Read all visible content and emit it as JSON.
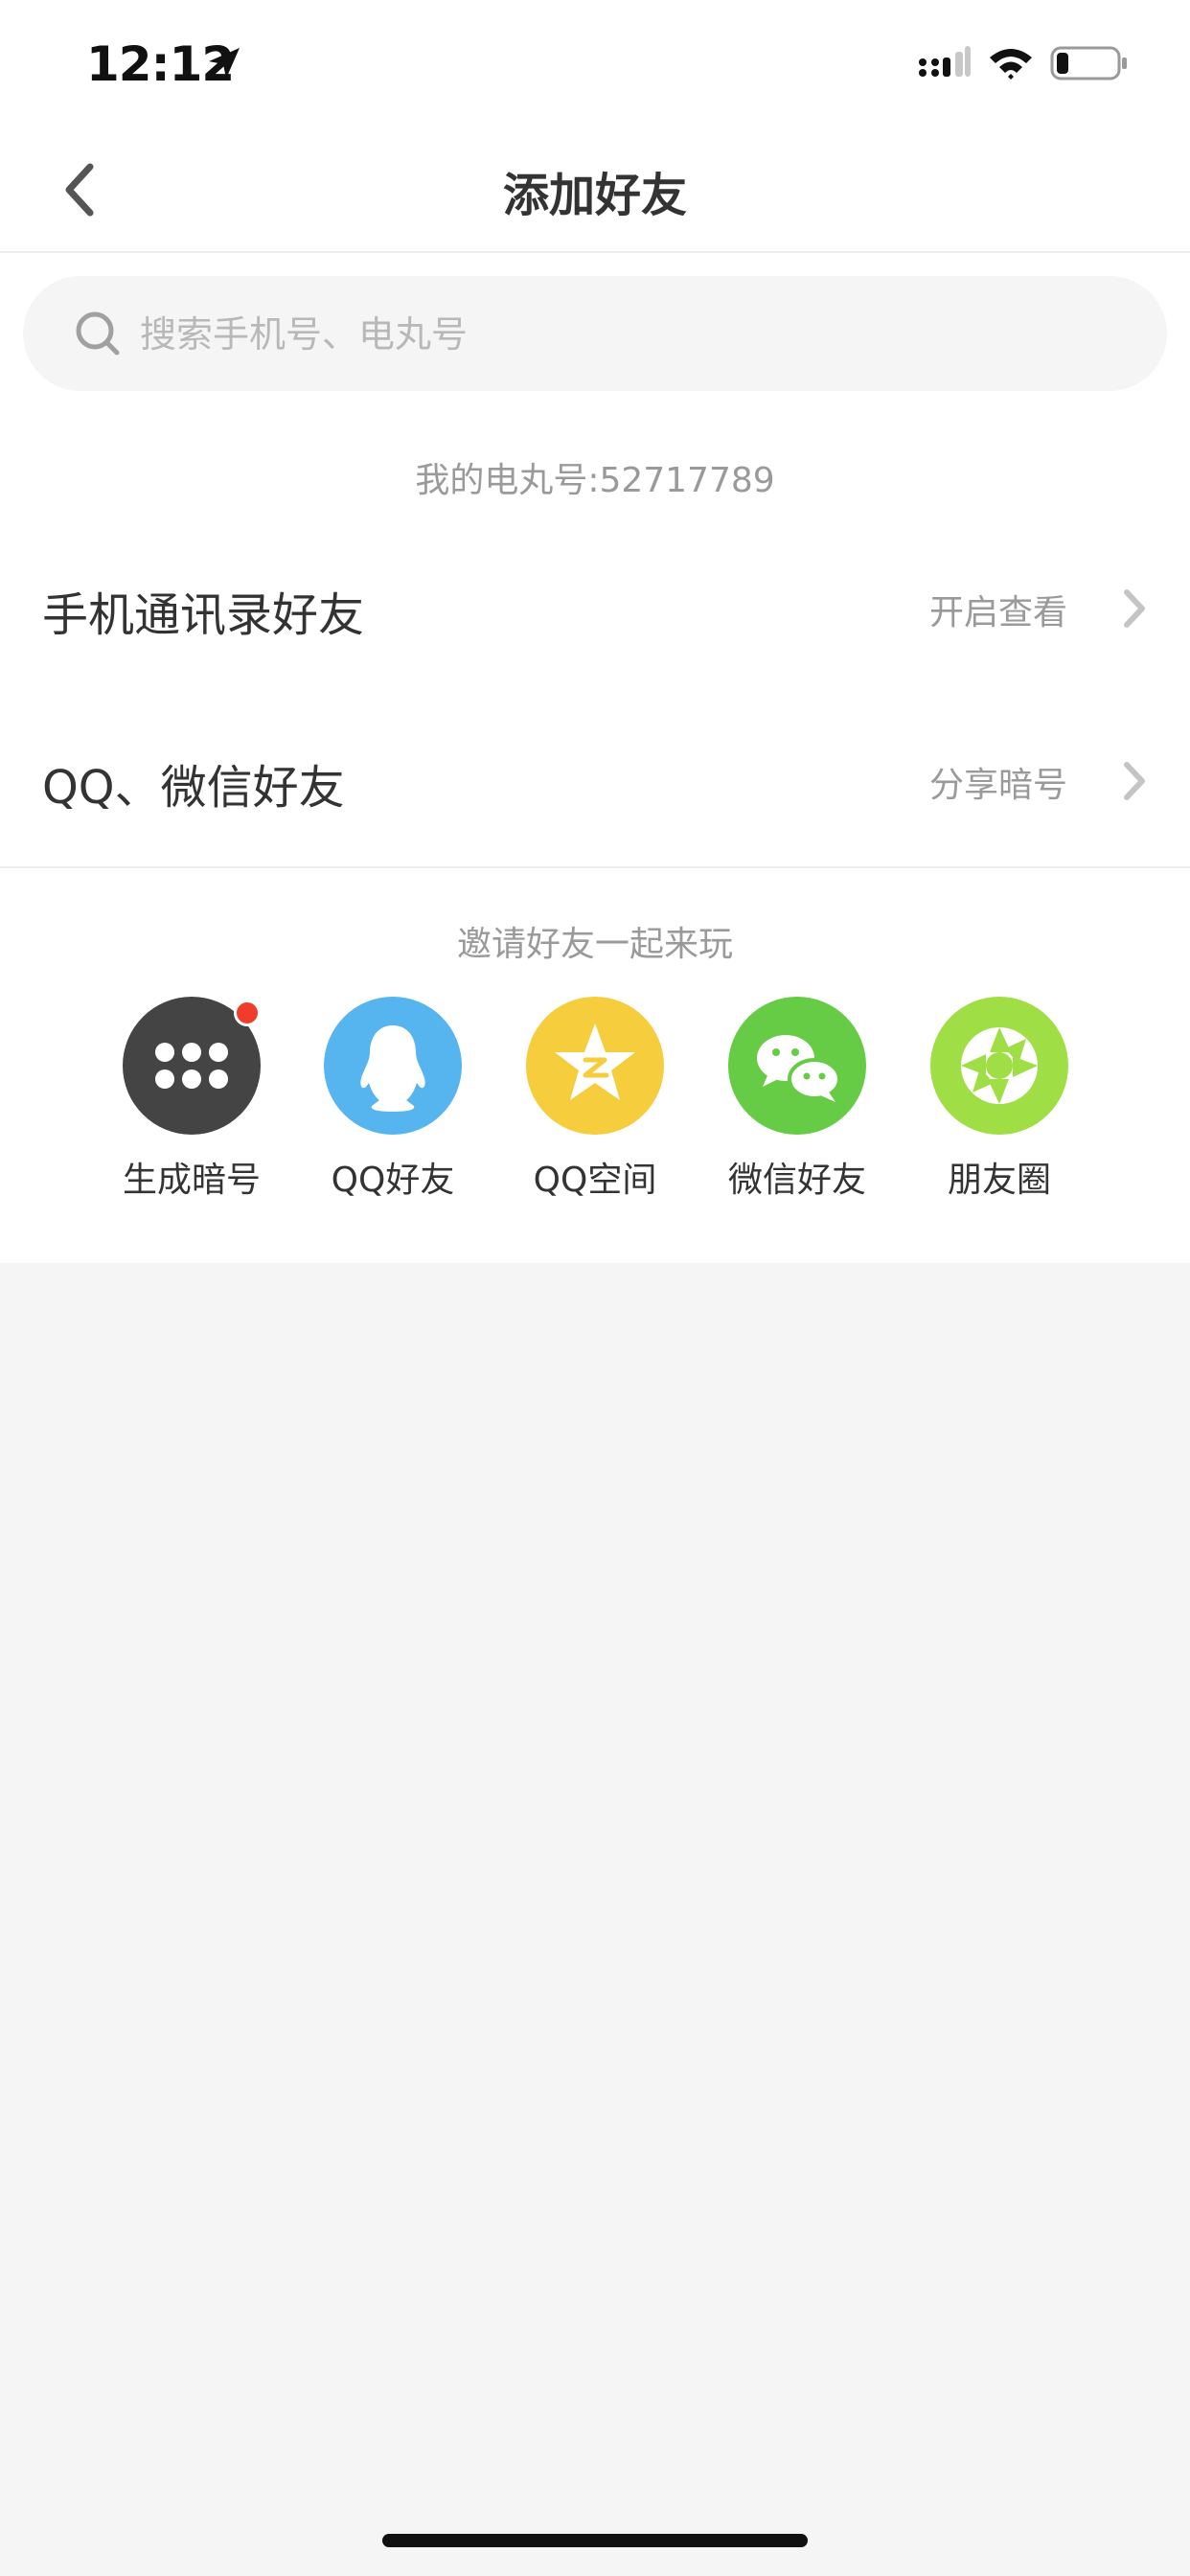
{
  "status_bar": {
    "time": "12:12"
  },
  "nav": {
    "title": "添加好友"
  },
  "search": {
    "placeholder": "搜索手机号、电丸号",
    "value": ""
  },
  "my_id": "我的电丸号:52717789",
  "rows": [
    {
      "title": "手机通讯录好友",
      "action": "开启查看"
    },
    {
      "title": "QQ、微信好友",
      "action": "分享暗号"
    }
  ],
  "invite": {
    "title": "邀请好友一起来玩",
    "items": [
      {
        "label": "生成暗号",
        "icon": "dots-grid-icon",
        "color": "#444444",
        "has_badge": true
      },
      {
        "label": "QQ好友",
        "icon": "qq-penguin-icon",
        "color": "#56b4ee"
      },
      {
        "label": "QQ空间",
        "icon": "qzone-star-icon",
        "color": "#f6cd3c"
      },
      {
        "label": "微信好友",
        "icon": "wechat-icon",
        "color": "#67cc45"
      },
      {
        "label": "朋友圈",
        "icon": "moments-aperture-icon",
        "color": "#a0de45"
      }
    ]
  },
  "colors": {
    "background": "#f5f5f5",
    "surface": "#ffffff",
    "text_primary": "#333333",
    "text_secondary": "#9a9a9a",
    "badge": "#f03c2a"
  }
}
